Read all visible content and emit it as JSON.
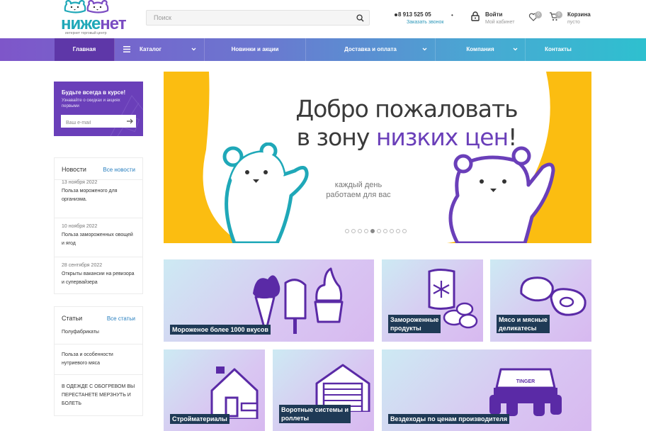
{
  "header": {
    "logo_main": "ниже",
    "logo_accent": "нет",
    "logo_sub": "интернет торговый центр",
    "search_placeholder": "Поиск",
    "phone": "8 913 525 05",
    "phone_more": "•",
    "callback": "Заказать звонок",
    "account_title": "Войти",
    "account_sub": "Мой кабинет",
    "favorites_count": "0",
    "cart_count": "0",
    "cart_title": "Корзина",
    "cart_sub": "пусто"
  },
  "nav": {
    "items": [
      {
        "label": "Главная"
      },
      {
        "label": "Каталог"
      },
      {
        "label": "Новинки и акции"
      },
      {
        "label": "Доставка и оплата"
      },
      {
        "label": "Компания"
      },
      {
        "label": "Контакты"
      }
    ]
  },
  "subscribe": {
    "title": "Будьте всегда в курсе!",
    "desc": "Узнавайте о скидках и акциях первыми",
    "placeholder": "Ваш e-mail"
  },
  "news": {
    "title": "Новости",
    "all_link": "Все новости",
    "items": [
      {
        "date": "13 ноября 2022",
        "text": "Польза мороженого для организма."
      },
      {
        "date": "10 ноября 2022",
        "text": "Польза замороженных овощей и ягод"
      },
      {
        "date": "28 сентября 2022",
        "text": "Открыты вакансии на ревизора и супервайзера"
      }
    ]
  },
  "articles": {
    "title": "Статьи",
    "all_link": "Все статьи",
    "items": [
      {
        "text": "Полуфабрикаты"
      },
      {
        "text": "Польза и особенности нутриевого мяса"
      },
      {
        "text": "В ОДЕЖДЕ С ОБОГРЕВОМ ВЫ ПЕРЕСТАНЕТЕ МЕРЗНУТЬ И БОЛЕТЬ"
      }
    ]
  },
  "hero": {
    "line1": "Добро пожаловать",
    "line2_pre": "в зону ",
    "line2_hl": "низких цен",
    "line2_post": "!",
    "sub1": "каждый день",
    "sub2": "работаем для вас",
    "slide_count": 10,
    "active_slide": 4
  },
  "categories": [
    {
      "caption": "Мороженое более 1000 вкусов"
    },
    {
      "caption1": "Замороженные",
      "caption2": "продукты"
    },
    {
      "caption1": "Мясо и мясные",
      "caption2": "деликатесы"
    },
    {
      "caption": "Стройматериалы"
    },
    {
      "caption1": "Воротные системы и",
      "caption2": "роллеты"
    },
    {
      "caption": "Вездеходы по ценам производителя"
    }
  ],
  "vehicle_plate": "TINGER",
  "colors": {
    "brand_purple": "#6a3fb9",
    "brand_teal": "#1fa8b8",
    "hero_yellow": "#fbbd11",
    "caption_bg": "#1f3a56"
  }
}
